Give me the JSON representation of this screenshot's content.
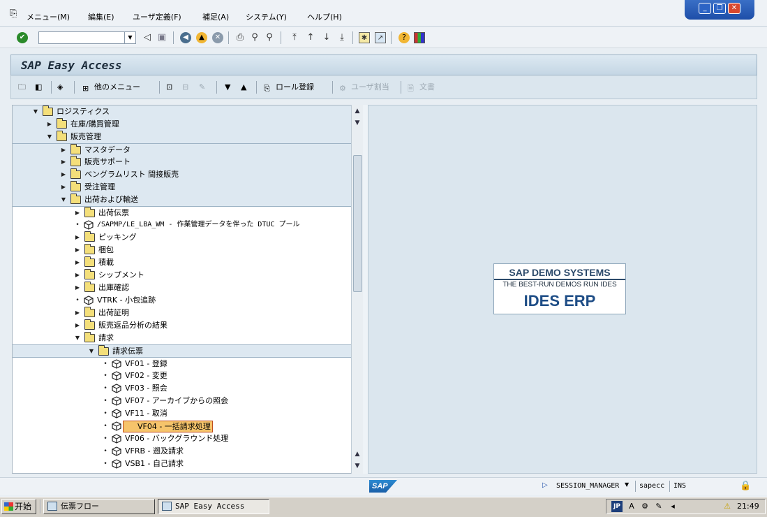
{
  "menubar": {
    "items": [
      {
        "label": "メニュー(M)"
      },
      {
        "label": "編集(E)"
      },
      {
        "label": "ユーザ定義(F)"
      },
      {
        "label": "補足(A)"
      },
      {
        "label": "システム(Y)"
      },
      {
        "label": "ヘルプ(H)"
      }
    ]
  },
  "title": "SAP Easy Access",
  "app_toolbar": {
    "other_menu": "他のメニュー",
    "role_register": "ロール登録",
    "user_assign": "ユーザ割当",
    "document": "文書"
  },
  "tree": {
    "rows": [
      {
        "label": "ロジスティクス"
      },
      {
        "label": "在庫/購買管理"
      },
      {
        "label": "販売管理"
      },
      {
        "label": "マスタデータ"
      },
      {
        "label": "販売サポート"
      },
      {
        "label": "ベングラムリスト 間接販売"
      },
      {
        "label": "受注管理"
      },
      {
        "label": "出荷および輸送"
      },
      {
        "label": "出荷伝票"
      },
      {
        "label": "/SAPMP/LE_LBA_WM - 作業管理データを伴った DTUC プール"
      },
      {
        "label": "ピッキング"
      },
      {
        "label": "梱包"
      },
      {
        "label": "積載"
      },
      {
        "label": "シップメント"
      },
      {
        "label": "出庫確認"
      },
      {
        "label": "VTRK - 小包追跡"
      },
      {
        "label": "出荷証明"
      },
      {
        "label": "販売返品分析の結果"
      },
      {
        "label": "請求"
      },
      {
        "label": "請求伝票"
      },
      {
        "label": "VF01 - 登録"
      },
      {
        "label": "VF02 - 変更"
      },
      {
        "label": "VF03 - 照会"
      },
      {
        "label": "VF07 - アーカイブからの照会"
      },
      {
        "label": "VF11 - 取消"
      },
      {
        "label": "VF04 - 一括請求処理"
      },
      {
        "label": "VF06 - バックグラウンド処理"
      },
      {
        "label": "VFRB - 遡及請求"
      },
      {
        "label": "VSB1 - 自己請求"
      }
    ]
  },
  "logo": {
    "line1": "SAP DEMO SYSTEMS",
    "line2": "THE BEST-RUN DEMOS RUN IDES",
    "line3": "IDES ERP"
  },
  "status": {
    "sap_logo": "SAP",
    "session": "SESSION_MANAGER",
    "server": "sapecc",
    "mode": "INS"
  },
  "taskbar": {
    "start": "开始",
    "task1": "伝票フロー",
    "task2": "SAP Easy Access",
    "ime": "JP",
    "time": "21:49"
  },
  "colors": {
    "accent": "#1e4d86",
    "selection": "#f6c46b"
  }
}
